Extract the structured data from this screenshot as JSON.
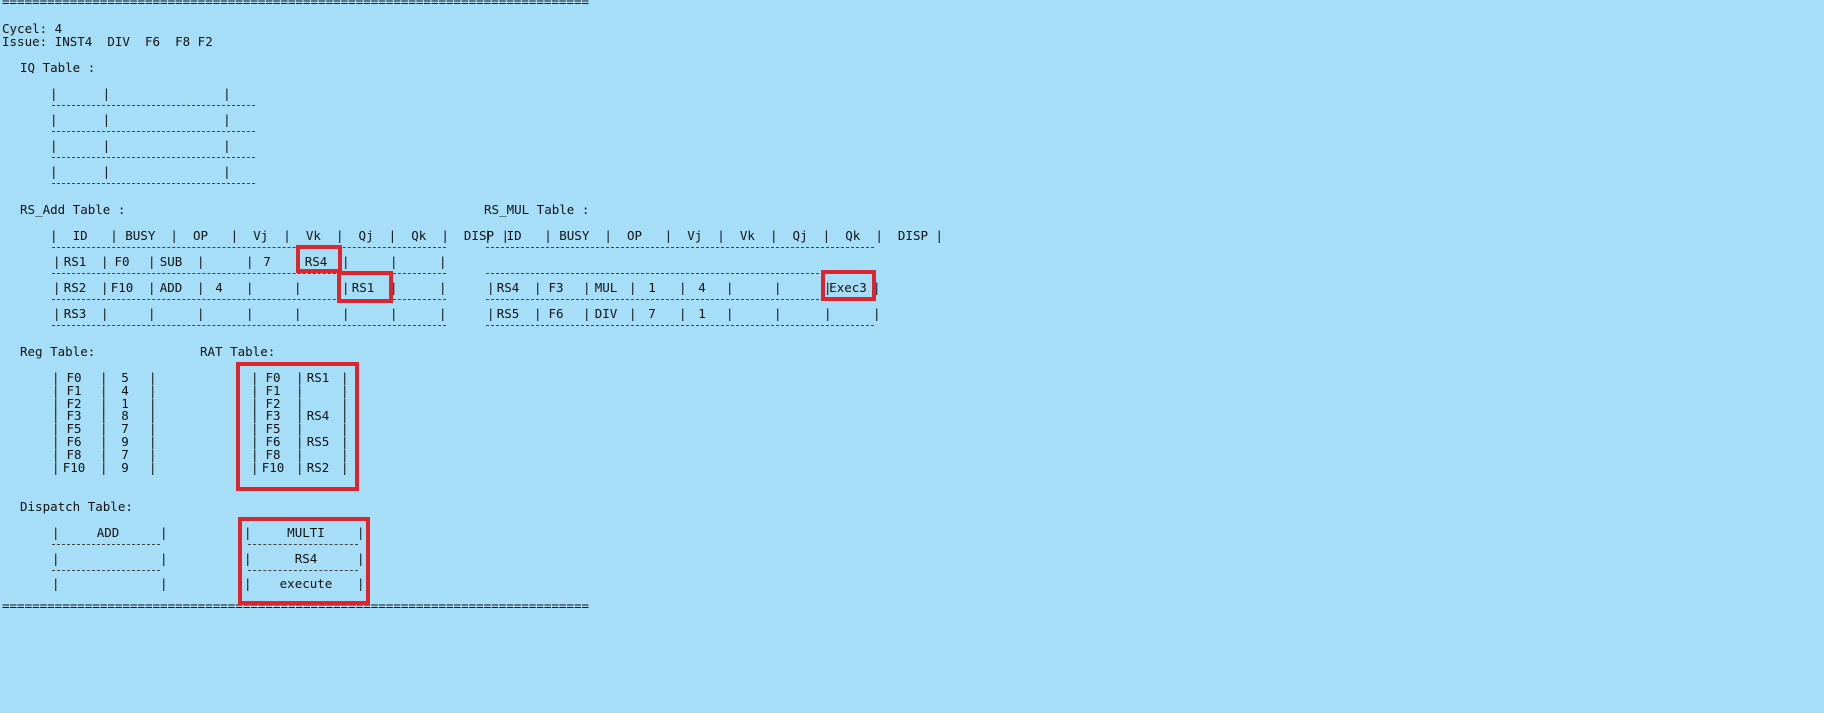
{
  "rule": "==============================================================================",
  "cycle_line": "Cycel: 4",
  "issue_line": "Issue: INST4  DIV  F6  F8 F2",
  "iq": {
    "title": "IQ Table :",
    "rows": [
      "|      |               |",
      "|      |               |",
      "|      |               |",
      "|      |               |"
    ]
  },
  "rs_add": {
    "title": "RS_Add Table :",
    "header": "|  ID   | BUSY  |  OP   |  Vj  |  Vk  |  Qj  |  Qk  |  DISP |",
    "rows": [
      {
        "id": "RS1",
        "busy": "F0",
        "op": "SUB",
        "vj": "",
        "vk": "7",
        "qj": "RS4",
        "qk": "",
        "disp": ""
      },
      {
        "id": "RS2",
        "busy": "F10",
        "op": "ADD",
        "vj": "4",
        "vk": "",
        "qj": "",
        "qk": "RS1",
        "disp": ""
      },
      {
        "id": "RS3",
        "busy": "",
        "op": "",
        "vj": "",
        "vk": "",
        "qj": "",
        "qk": "",
        "disp": ""
      }
    ]
  },
  "rs_mul": {
    "title": "RS_MUL Table :",
    "header": "|  ID   | BUSY  |  OP   |  Vj  |  Vk  |  Qj  |  Qk  |  DISP |",
    "rows": [
      {
        "id": "",
        "busy": "",
        "op": "",
        "vj": "",
        "vk": "",
        "qj": "",
        "qk": "",
        "disp": ""
      },
      {
        "id": "RS4",
        "busy": "F3",
        "op": "MUL",
        "vj": "1",
        "vk": "4",
        "qj": "",
        "qk": "",
        "disp": "Exec3"
      },
      {
        "id": "RS5",
        "busy": "F6",
        "op": "DIV",
        "vj": "7",
        "vk": "1",
        "qj": "",
        "qk": "",
        "disp": ""
      }
    ]
  },
  "reg": {
    "title": "Reg Table:",
    "rows": [
      {
        "reg": "F0",
        "val": "5"
      },
      {
        "reg": "F1",
        "val": "4"
      },
      {
        "reg": "F2",
        "val": "1"
      },
      {
        "reg": "F3",
        "val": "8"
      },
      {
        "reg": "F5",
        "val": "7"
      },
      {
        "reg": "F6",
        "val": "9"
      },
      {
        "reg": "F8",
        "val": "7"
      },
      {
        "reg": "F10",
        "val": "9"
      }
    ]
  },
  "rat": {
    "title": "RAT Table:",
    "rows": [
      {
        "reg": "F0",
        "tag": "RS1"
      },
      {
        "reg": "F1",
        "tag": ""
      },
      {
        "reg": "F2",
        "tag": ""
      },
      {
        "reg": "F3",
        "tag": "RS4"
      },
      {
        "reg": "F5",
        "tag": ""
      },
      {
        "reg": "F6",
        "tag": "RS5"
      },
      {
        "reg": "F8",
        "tag": ""
      },
      {
        "reg": "F10",
        "tag": "RS2"
      }
    ]
  },
  "dispatch": {
    "title": "Dispatch Table:",
    "add": [
      "ADD",
      "",
      ""
    ],
    "multi": [
      "MULTI",
      "RS4",
      "execute"
    ]
  },
  "colors": {
    "background": "#a6def8",
    "highlight": "#e0242e"
  }
}
